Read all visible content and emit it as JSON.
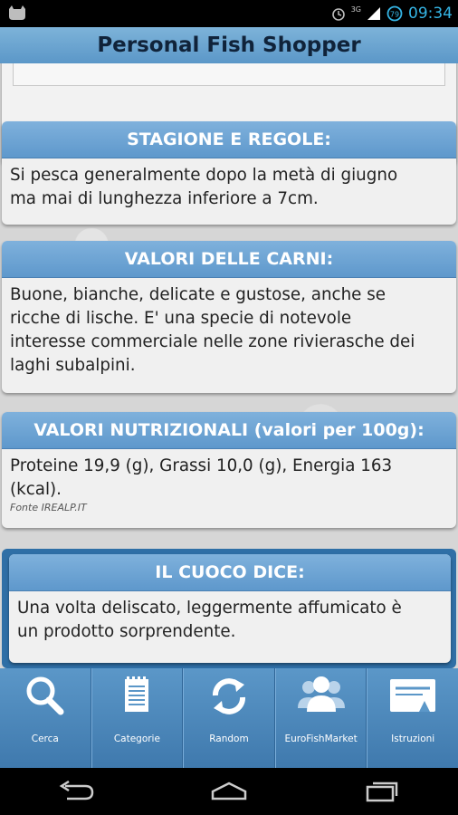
{
  "status_bar": {
    "time": "09:34",
    "network": "3G"
  },
  "app": {
    "title": "Personal Fish Shopper"
  },
  "sections": [
    {
      "header": "STAGIONE E REGOLE:",
      "lines": [
        "Si pesca generalmente dopo la metà di giugno",
        "ma mai di lunghezza inferiore a 7cm."
      ]
    },
    {
      "header": "VALORI DELLE CARNI:",
      "lines": [
        "Buone, bianche, delicate e gustose, anche se",
        "ricche di lische. E' una specie di notevole",
        "interesse commerciale nelle zone rivierasche dei",
        "laghi subalpini."
      ]
    },
    {
      "header": "VALORI NUTRIZIONALI (valori per 100g):",
      "lines": [
        "Proteine 19,9 (g), Grassi 10,0 (g), Energia 163",
        "(kcal)."
      ],
      "source": "Fonte IREALP.IT"
    },
    {
      "header": "IL CUOCO DICE:",
      "lines": [
        "Una volta deliscato, leggermente affumicato è",
        "un prodotto sorprendente."
      ]
    }
  ],
  "bottom_nav": [
    {
      "label": "Cerca",
      "icon": "search-icon"
    },
    {
      "label": "Categorie",
      "icon": "notepad-icon"
    },
    {
      "label": "Random",
      "icon": "refresh-icon"
    },
    {
      "label": "EuroFishMarket",
      "icon": "users-icon"
    },
    {
      "label": "Istruzioni",
      "icon": "ticket-icon"
    }
  ],
  "colors": {
    "header_blue": "#6aa3d2",
    "title_text": "#10233a",
    "clock": "#35b5e5"
  }
}
